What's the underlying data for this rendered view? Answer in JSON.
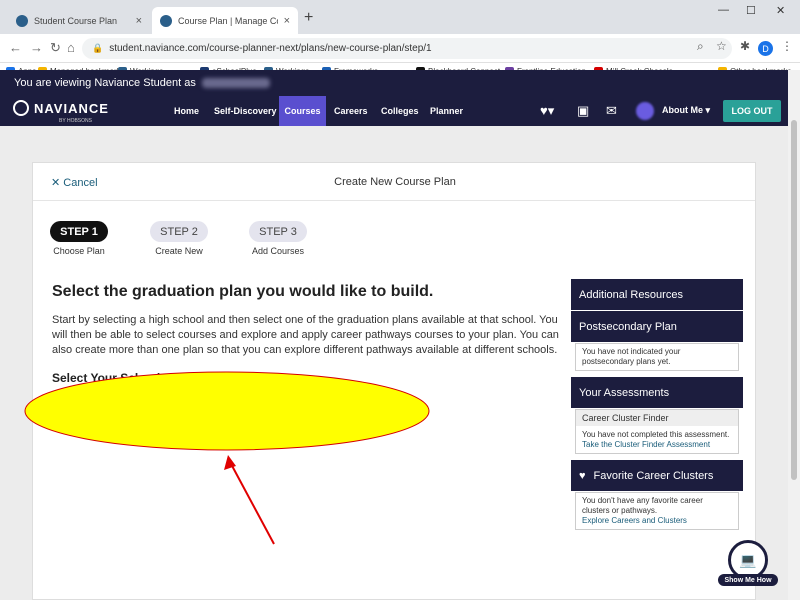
{
  "browser": {
    "tabs": [
      {
        "title": "Student Course Plan",
        "close": "×"
      },
      {
        "title": "Course Plan | Manage Course Pl...",
        "close": "×"
      }
    ],
    "new_tab": "+",
    "url": "student.naviance.com/course-planner-next/plans/new-course-plan/step/1",
    "profile_initial": "D",
    "bookmarks": [
      {
        "label": "Apps",
        "color": "#1a73e8"
      },
      {
        "label": "Managed bookmarks",
        "color": "#f4b400"
      },
      {
        "label": "Workings...",
        "color": "#2b5f8a"
      },
      {
        "label": "eSchoolPlus",
        "color": "#1c3a70"
      },
      {
        "label": "Workings...",
        "color": "#2b5f8a"
      },
      {
        "label": "Frameworks - ...",
        "color": "#1a5fb4"
      },
      {
        "label": "Blackboard Connect",
        "color": "#111111"
      },
      {
        "label": "Frontline Education",
        "color": "#6b3fa0"
      },
      {
        "label": "Mill Creek Chocola...",
        "color": "#d40000"
      },
      {
        "label": "Other bookmarks",
        "color": "#f4b400"
      }
    ]
  },
  "viewing_banner": "You are viewing Naviance Student as",
  "viewing_name": "Jocelyn Boyd",
  "brand": {
    "name": "NAVIANCE",
    "sub": "BY HOBSONS"
  },
  "nav": {
    "links": [
      "Home",
      "Self-Discovery",
      "Courses",
      "Careers",
      "Colleges",
      "Planner"
    ],
    "active": "Courses",
    "about": "About Me ▾",
    "logout": "LOG OUT"
  },
  "card": {
    "cancel": "✕ Cancel",
    "title": "Create New Course Plan",
    "steps": [
      {
        "label": "STEP 1",
        "sub": "Choose Plan",
        "active": true
      },
      {
        "label": "STEP 2",
        "sub": "Create New",
        "active": false
      },
      {
        "label": "STEP 3",
        "sub": "Add Courses",
        "active": false
      }
    ],
    "heading": "Select the graduation plan you would like to build.",
    "description": "Start by selecting a high school and then select one of the graduation plans available at that school. You will then be able to select courses and explore and apply career pathways courses to your plan. You can also create more than one plan so that you can explore different pathways available at different schools.",
    "select_label": "Select Your School"
  },
  "sidebar": {
    "additional_resources": "Additional Resources",
    "postsecondary_title": "Postsecondary Plan",
    "postsecondary_text": "You have not indicated your postsecondary plans yet.",
    "assessments_title": "Your Assessments",
    "cluster_finder_title": "Career Cluster Finder",
    "cluster_finder_text": "You have not completed this assessment.",
    "cluster_finder_link": "Take the Cluster Finder Assessment",
    "favorites_title": "Favorite Career Clusters",
    "favorites_text": "You don't have any favorite career clusters or pathways.",
    "favorites_link": "Explore Careers and Clusters"
  },
  "show_me_how": "Show Me How",
  "colors": {
    "nav_bg": "#1c1d3e",
    "active_nav": "#5a4fcf",
    "logout": "#2aa198",
    "highlight": "#ffff00",
    "arrow": "#e00000"
  }
}
